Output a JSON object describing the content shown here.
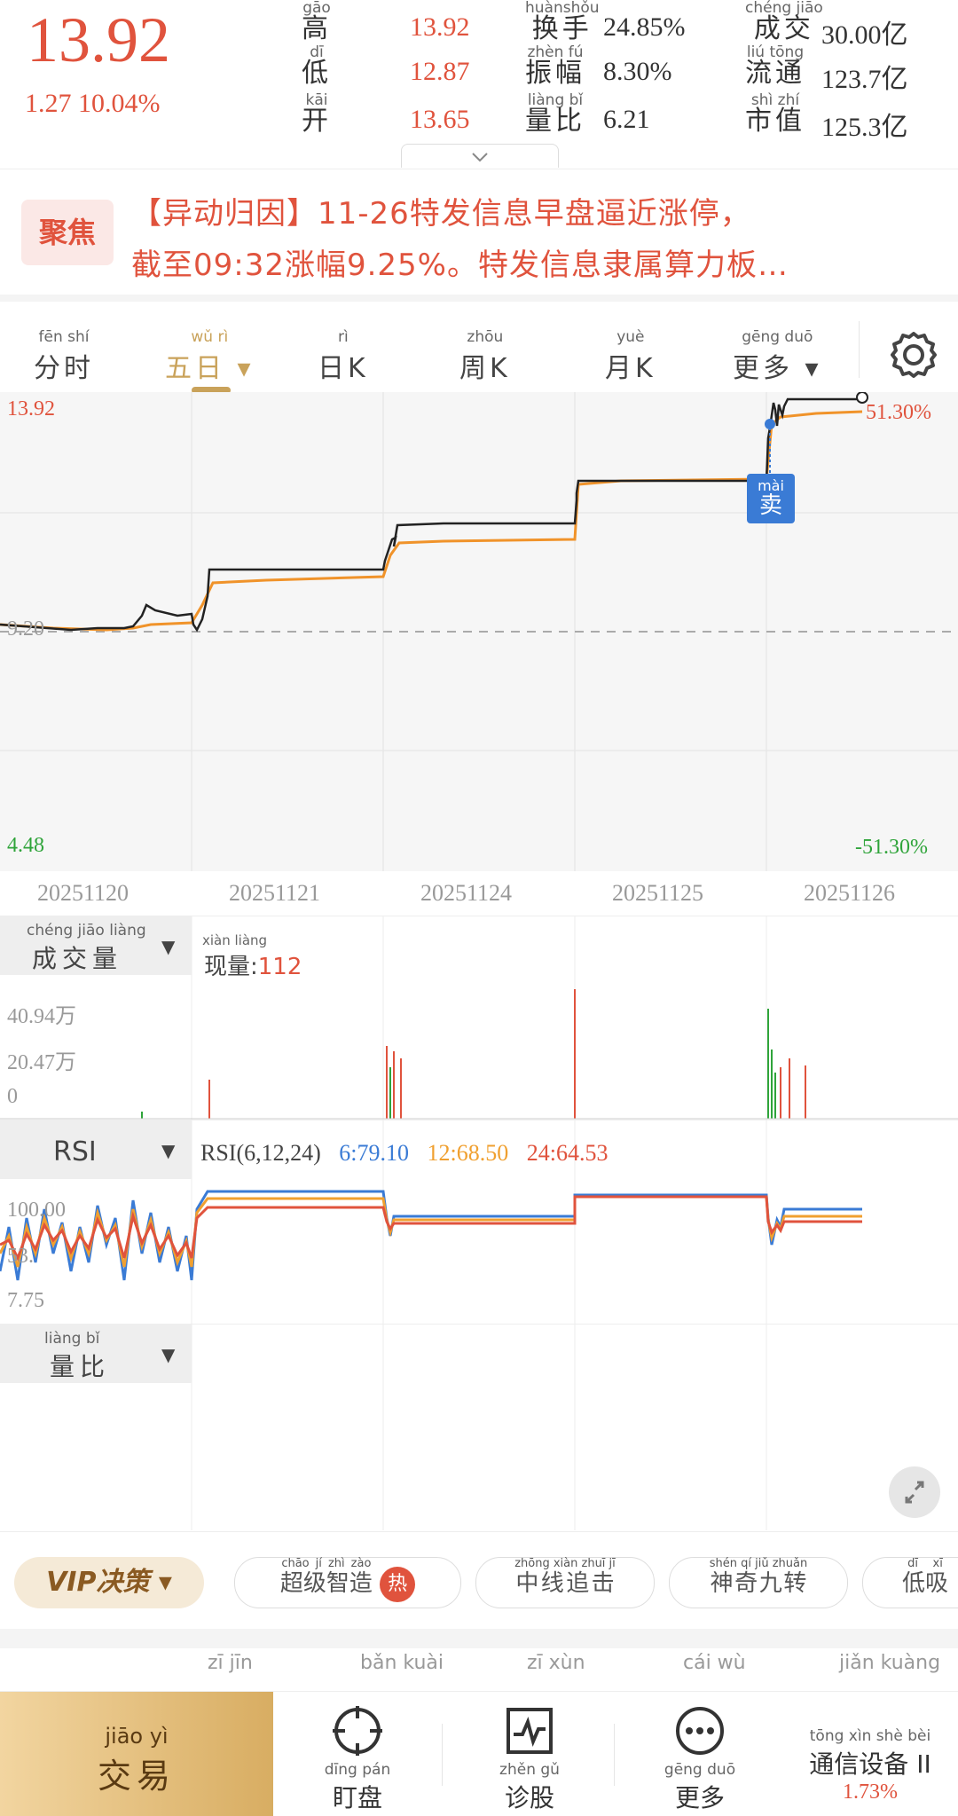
{
  "quote": {
    "price": "13.92",
    "change": "1.27",
    "change_pct": "10.04%",
    "stats": [
      {
        "label_py": "gāo",
        "label": "高",
        "value": "13.92",
        "value_color": "red"
      },
      {
        "label_py": "huànshǒu",
        "label": "换手",
        "value": "24.85%",
        "value_color": "dark"
      },
      {
        "label_py": "chéng jiāo",
        "label": "成交",
        "value": "30.00亿",
        "value_color": "dark"
      },
      {
        "label_py": "dī",
        "label": "低",
        "value": "12.87",
        "value_color": "red"
      },
      {
        "label_py": "zhèn fú",
        "label": "振幅",
        "value": "8.30%",
        "value_color": "dark"
      },
      {
        "label_py": "liú tōng",
        "label": "流通",
        "value": "123.7亿",
        "value_color": "dark"
      },
      {
        "label_py": "kāi",
        "label": "开",
        "value": "13.65",
        "value_color": "red"
      },
      {
        "label_py": "liàng bǐ",
        "label": "量比",
        "value": "6.21",
        "value_color": "dark"
      },
      {
        "label_py": "shì zhí",
        "label": "市值",
        "value": "125.3亿",
        "value_color": "dark"
      }
    ]
  },
  "banner": {
    "badge": "聚焦",
    "line1": "【异动归因】11-26特发信息早盘逼近涨停，",
    "line2": "截至09:32涨幅9.25%。特发信息隶属算力板…"
  },
  "tabs": [
    {
      "py": "fēn shí",
      "label": "分时",
      "active": false
    },
    {
      "py": "wǔ rì",
      "label": "五日 ▾",
      "active": true
    },
    {
      "py": "rì",
      "label": "日K",
      "active": false
    },
    {
      "py": "zhōu",
      "label": "周K",
      "active": false
    },
    {
      "py": "yuè",
      "label": "月K",
      "active": false
    },
    {
      "py": "gēng duō",
      "label": "更多 ▾",
      "active": false
    }
  ],
  "main_chart": {
    "y_top": "13.92",
    "y_mid": "9.20",
    "y_bottom": "4.48",
    "pct_top": "51.30%",
    "pct_bottom": "-51.30%",
    "sell_marker_py": "mài",
    "sell_marker": "卖",
    "dates": [
      "20251120",
      "20251121",
      "20251124",
      "20251125",
      "20251126"
    ]
  },
  "volume_panel": {
    "label_py": "chéng jiāo liàng",
    "label": "成交量",
    "current_py": "xiàn liàng",
    "current_label": "现量:",
    "current_value": "112",
    "y_labels": [
      "40.94万",
      "20.47万",
      "0"
    ]
  },
  "rsi_panel": {
    "label": "RSI",
    "params": "RSI(6,12,24)",
    "rsi6": "6:79.10",
    "rsi12": "12:68.50",
    "rsi24": "24:64.53",
    "y_labels": [
      "100.00",
      "53.",
      "7.75"
    ]
  },
  "lb_panel": {
    "label_py": "liàng bǐ",
    "label": "量比"
  },
  "toolbar": {
    "vip": "VIP决策 ▾",
    "pills": [
      {
        "py": "chāo jí zhì zào",
        "label": "超级智造",
        "hot": "热"
      },
      {
        "py": "zhōng xiàn zhuī jī",
        "label": "中线追击"
      },
      {
        "py": "shén qí jiǔ zhuǎn",
        "label": "神奇九转"
      },
      {
        "py": "dī xī",
        "label": "低吸"
      }
    ]
  },
  "subtabs": [
    "zī jīn",
    "bǎn kuài",
    "zī xùn",
    "cái wù",
    "jiǎn kuàng"
  ],
  "bottom_nav": {
    "trade_py": "jiāo yì",
    "trade": "交易",
    "items": [
      {
        "py": "dīng pán",
        "label": "盯盘",
        "icon": "target-icon"
      },
      {
        "py": "zhěn gǔ",
        "label": "诊股",
        "icon": "pulse-chart-icon"
      },
      {
        "py": "gēng duō",
        "label": "更多",
        "icon": "more-dots-icon"
      }
    ],
    "sector_py": "tōng xìn shè bèi",
    "sector": "通信设备",
    "sector_pct": "1.73%",
    "sector_suffix": "II"
  },
  "colors": {
    "up": "#e0533d",
    "down": "#2fa43a",
    "price_line": "#222222",
    "avg_line": "#f0932a",
    "rsi6": "#3a7bd5",
    "rsi12": "#f0a030",
    "rsi24": "#e0533d",
    "accent_gold": "#c9a25a"
  }
}
